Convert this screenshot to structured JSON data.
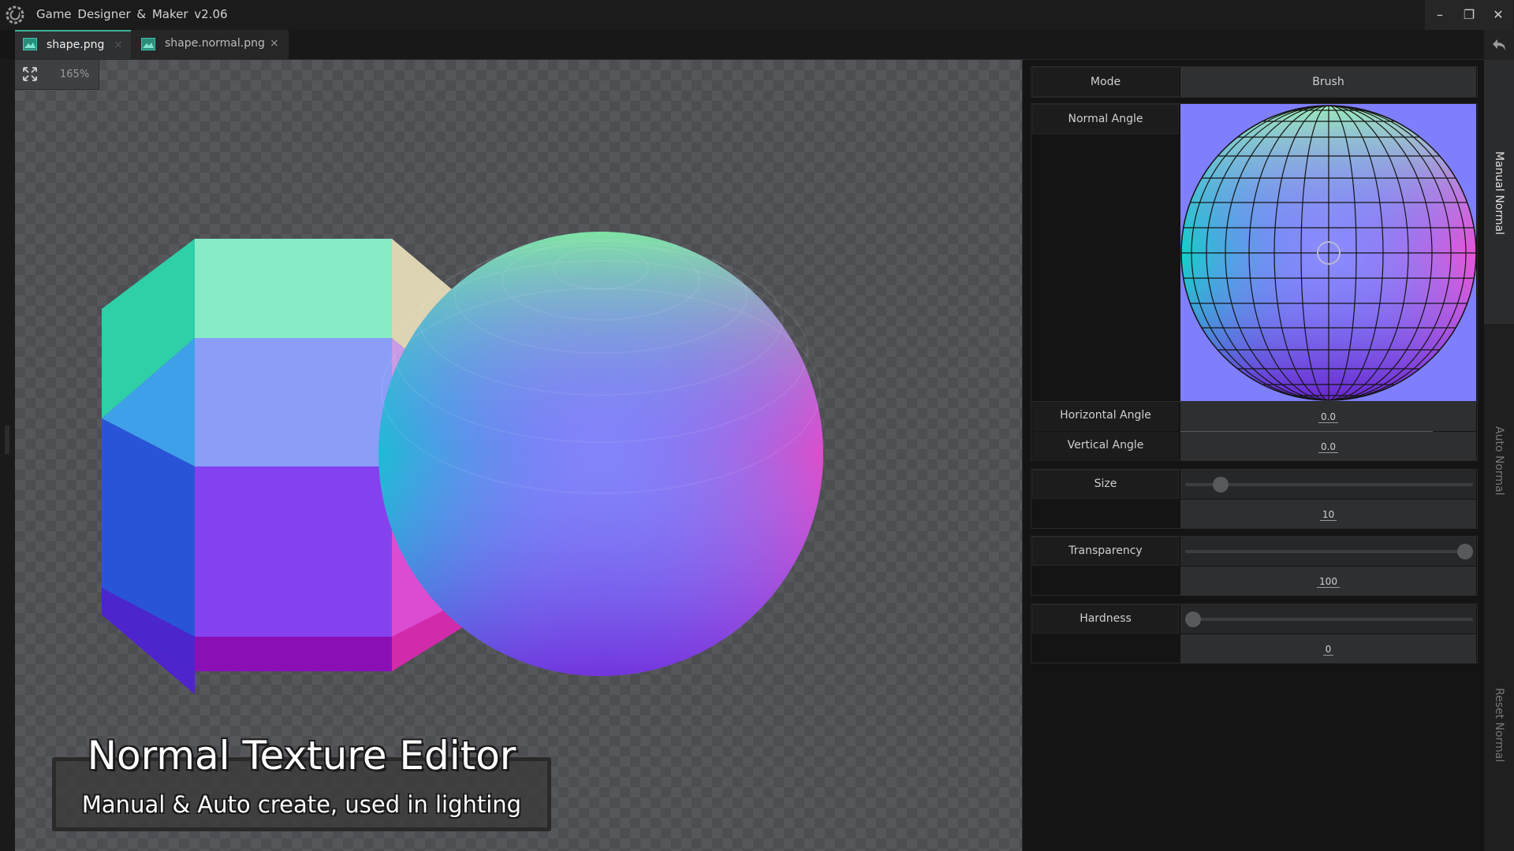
{
  "window": {
    "title": "Game Designer & Maker v2.06",
    "minimize_glyph": "–",
    "restore_glyph": "❐",
    "close_glyph": "✕"
  },
  "tabs": [
    {
      "label": "shape.png",
      "active": true,
      "icon": "image-icon",
      "close": "×"
    },
    {
      "label": "shape.normal.png",
      "active": false,
      "icon": "image-icon",
      "close": "×"
    }
  ],
  "canvas": {
    "zoom": "165%"
  },
  "caption": {
    "title": "Normal Texture Editor",
    "subtitle": "Manual & Auto create, used in lighting"
  },
  "panel": {
    "mode": {
      "label": "Mode",
      "value": "Brush"
    },
    "normal_angle": {
      "label": "Normal Angle"
    },
    "horizontal_angle": {
      "label": "Horizontal Angle",
      "value": "0.0"
    },
    "vertical_angle": {
      "label": "Vertical Angle",
      "value": "0.0"
    },
    "size": {
      "label": "Size",
      "value": "10",
      "level": 0.1
    },
    "transparency": {
      "label": "Transparency",
      "value": "100",
      "level": 1.0
    },
    "hardness": {
      "label": "Hardness",
      "value": "0",
      "level": 0.0
    }
  },
  "side_tabs": [
    "Manual Normal",
    "Auto Normal",
    "Reset Normal"
  ],
  "colors": {
    "accent": "#3fb09a",
    "normal_flat": "#7f7ffe"
  }
}
